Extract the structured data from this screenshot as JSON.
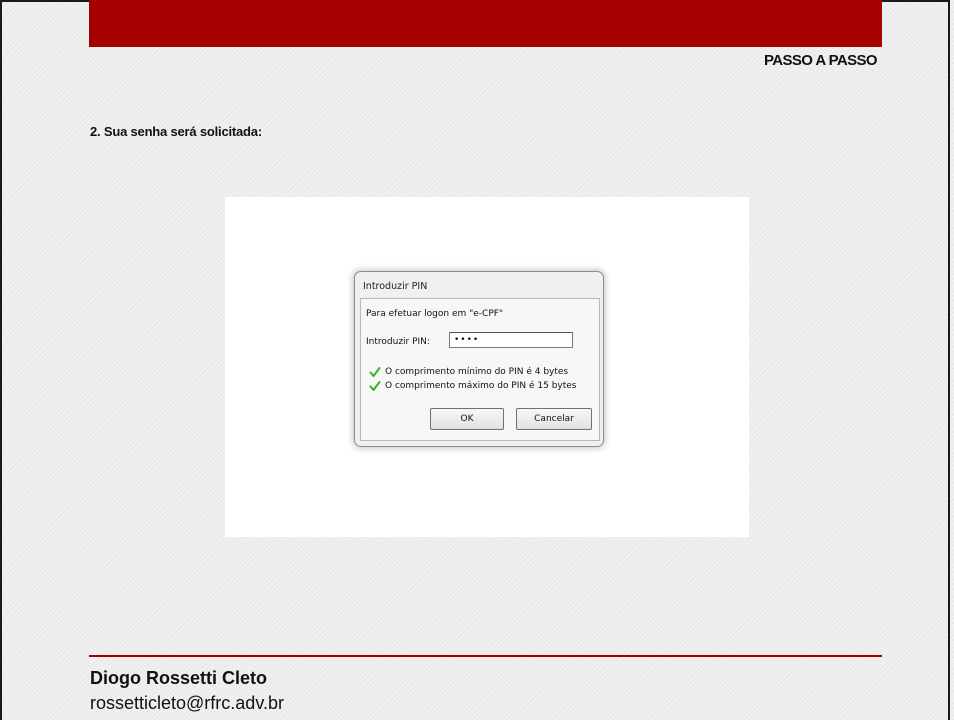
{
  "header": {
    "section_label": "PASSO A PASSO",
    "accent_color": "#a50000"
  },
  "step": {
    "text": "2. Sua senha será solicitada:"
  },
  "dialog": {
    "title": "Introduzir PIN",
    "logon_text": "Para efetuar logon em \"e-CPF\"",
    "pin_label": "Introduzir PIN:",
    "pin_value": "••••",
    "rules": [
      {
        "icon": "check-icon",
        "text": "O comprimento mínimo do PIN é 4 bytes"
      },
      {
        "icon": "check-icon",
        "text": "O comprimento máximo do PIN é 15 bytes"
      }
    ],
    "ok_label": "OK",
    "cancel_label": "Cancelar"
  },
  "footer": {
    "name": "Diogo Rossetti Cleto",
    "email": "rossetticleto@rfrc.adv.br"
  }
}
